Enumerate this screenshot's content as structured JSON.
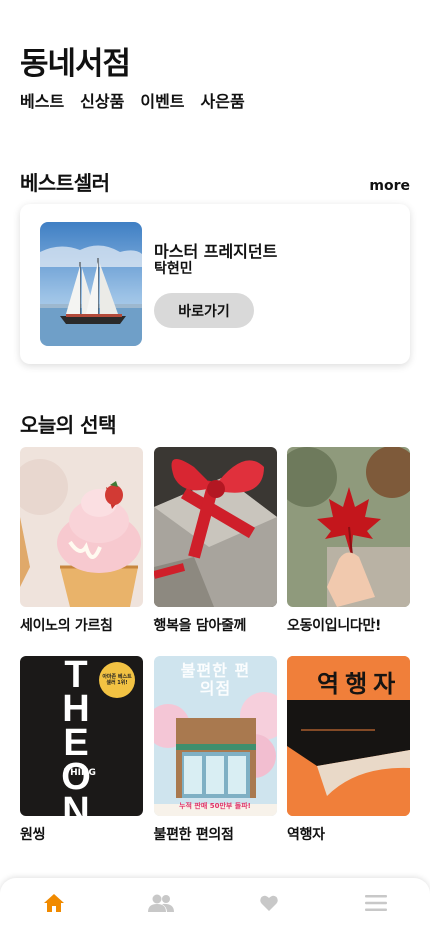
{
  "header": {
    "title": "동네서점"
  },
  "top_nav": [
    "베스트",
    "신상품",
    "이벤트",
    "사은품"
  ],
  "bestseller": {
    "title": "베스트셀러",
    "more_label": "more",
    "book": {
      "title": "마스터 프레지던트",
      "author": "탁현민",
      "button_label": "바로가기"
    }
  },
  "todays_pick": {
    "title": "오늘의 선택",
    "items": [
      {
        "label": "세이노의 가르침"
      },
      {
        "label": "행복을 담아줄께"
      },
      {
        "label": "오동이입니다만!"
      },
      {
        "label": "원씽"
      },
      {
        "label": "불편한 편의점"
      },
      {
        "label": "역행자"
      }
    ]
  },
  "covers": {
    "one_thing": {
      "big": "THE ONE",
      "sub": "THING",
      "badge": "아마존 베스트셀러 1위!"
    },
    "convenience": {
      "title": "불편한 편의점",
      "band": "누적 판매 50만부 돌파!"
    },
    "reverse": {
      "title": "역행자"
    }
  },
  "bottom_nav": [
    "home-icon",
    "people-icon",
    "heart-icon",
    "menu-icon"
  ],
  "colors": {
    "accent": "#f08a00",
    "inactive": "#c8c8c8",
    "button_bg": "#d9d9d9"
  }
}
